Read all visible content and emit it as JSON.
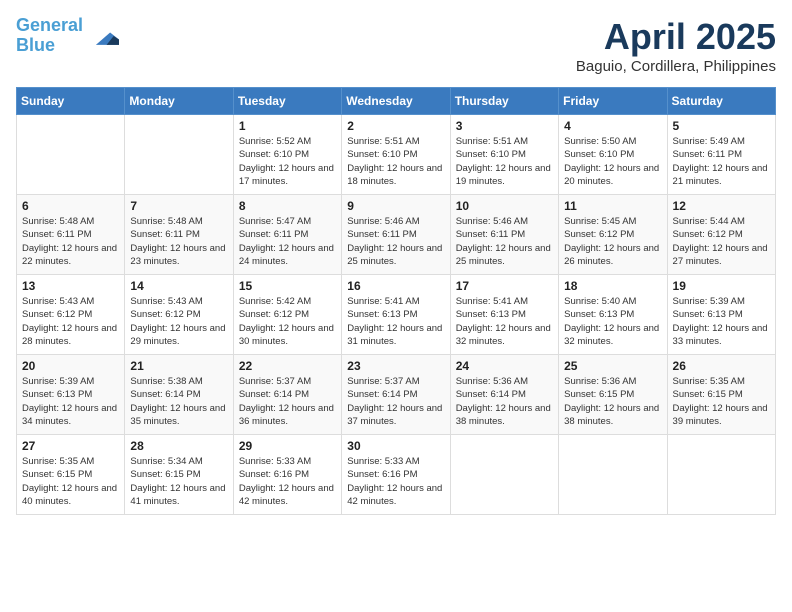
{
  "header": {
    "logo_line1": "General",
    "logo_line2": "Blue",
    "month_title": "April 2025",
    "location": "Baguio, Cordillera, Philippines"
  },
  "weekdays": [
    "Sunday",
    "Monday",
    "Tuesday",
    "Wednesday",
    "Thursday",
    "Friday",
    "Saturday"
  ],
  "weeks": [
    [
      {
        "day": "",
        "info": ""
      },
      {
        "day": "",
        "info": ""
      },
      {
        "day": "1",
        "info": "Sunrise: 5:52 AM\nSunset: 6:10 PM\nDaylight: 12 hours and 17 minutes."
      },
      {
        "day": "2",
        "info": "Sunrise: 5:51 AM\nSunset: 6:10 PM\nDaylight: 12 hours and 18 minutes."
      },
      {
        "day": "3",
        "info": "Sunrise: 5:51 AM\nSunset: 6:10 PM\nDaylight: 12 hours and 19 minutes."
      },
      {
        "day": "4",
        "info": "Sunrise: 5:50 AM\nSunset: 6:10 PM\nDaylight: 12 hours and 20 minutes."
      },
      {
        "day": "5",
        "info": "Sunrise: 5:49 AM\nSunset: 6:11 PM\nDaylight: 12 hours and 21 minutes."
      }
    ],
    [
      {
        "day": "6",
        "info": "Sunrise: 5:48 AM\nSunset: 6:11 PM\nDaylight: 12 hours and 22 minutes."
      },
      {
        "day": "7",
        "info": "Sunrise: 5:48 AM\nSunset: 6:11 PM\nDaylight: 12 hours and 23 minutes."
      },
      {
        "day": "8",
        "info": "Sunrise: 5:47 AM\nSunset: 6:11 PM\nDaylight: 12 hours and 24 minutes."
      },
      {
        "day": "9",
        "info": "Sunrise: 5:46 AM\nSunset: 6:11 PM\nDaylight: 12 hours and 25 minutes."
      },
      {
        "day": "10",
        "info": "Sunrise: 5:46 AM\nSunset: 6:11 PM\nDaylight: 12 hours and 25 minutes."
      },
      {
        "day": "11",
        "info": "Sunrise: 5:45 AM\nSunset: 6:12 PM\nDaylight: 12 hours and 26 minutes."
      },
      {
        "day": "12",
        "info": "Sunrise: 5:44 AM\nSunset: 6:12 PM\nDaylight: 12 hours and 27 minutes."
      }
    ],
    [
      {
        "day": "13",
        "info": "Sunrise: 5:43 AM\nSunset: 6:12 PM\nDaylight: 12 hours and 28 minutes."
      },
      {
        "day": "14",
        "info": "Sunrise: 5:43 AM\nSunset: 6:12 PM\nDaylight: 12 hours and 29 minutes."
      },
      {
        "day": "15",
        "info": "Sunrise: 5:42 AM\nSunset: 6:12 PM\nDaylight: 12 hours and 30 minutes."
      },
      {
        "day": "16",
        "info": "Sunrise: 5:41 AM\nSunset: 6:13 PM\nDaylight: 12 hours and 31 minutes."
      },
      {
        "day": "17",
        "info": "Sunrise: 5:41 AM\nSunset: 6:13 PM\nDaylight: 12 hours and 32 minutes."
      },
      {
        "day": "18",
        "info": "Sunrise: 5:40 AM\nSunset: 6:13 PM\nDaylight: 12 hours and 32 minutes."
      },
      {
        "day": "19",
        "info": "Sunrise: 5:39 AM\nSunset: 6:13 PM\nDaylight: 12 hours and 33 minutes."
      }
    ],
    [
      {
        "day": "20",
        "info": "Sunrise: 5:39 AM\nSunset: 6:13 PM\nDaylight: 12 hours and 34 minutes."
      },
      {
        "day": "21",
        "info": "Sunrise: 5:38 AM\nSunset: 6:14 PM\nDaylight: 12 hours and 35 minutes."
      },
      {
        "day": "22",
        "info": "Sunrise: 5:37 AM\nSunset: 6:14 PM\nDaylight: 12 hours and 36 minutes."
      },
      {
        "day": "23",
        "info": "Sunrise: 5:37 AM\nSunset: 6:14 PM\nDaylight: 12 hours and 37 minutes."
      },
      {
        "day": "24",
        "info": "Sunrise: 5:36 AM\nSunset: 6:14 PM\nDaylight: 12 hours and 38 minutes."
      },
      {
        "day": "25",
        "info": "Sunrise: 5:36 AM\nSunset: 6:15 PM\nDaylight: 12 hours and 38 minutes."
      },
      {
        "day": "26",
        "info": "Sunrise: 5:35 AM\nSunset: 6:15 PM\nDaylight: 12 hours and 39 minutes."
      }
    ],
    [
      {
        "day": "27",
        "info": "Sunrise: 5:35 AM\nSunset: 6:15 PM\nDaylight: 12 hours and 40 minutes."
      },
      {
        "day": "28",
        "info": "Sunrise: 5:34 AM\nSunset: 6:15 PM\nDaylight: 12 hours and 41 minutes."
      },
      {
        "day": "29",
        "info": "Sunrise: 5:33 AM\nSunset: 6:16 PM\nDaylight: 12 hours and 42 minutes."
      },
      {
        "day": "30",
        "info": "Sunrise: 5:33 AM\nSunset: 6:16 PM\nDaylight: 12 hours and 42 minutes."
      },
      {
        "day": "",
        "info": ""
      },
      {
        "day": "",
        "info": ""
      },
      {
        "day": "",
        "info": ""
      }
    ]
  ]
}
